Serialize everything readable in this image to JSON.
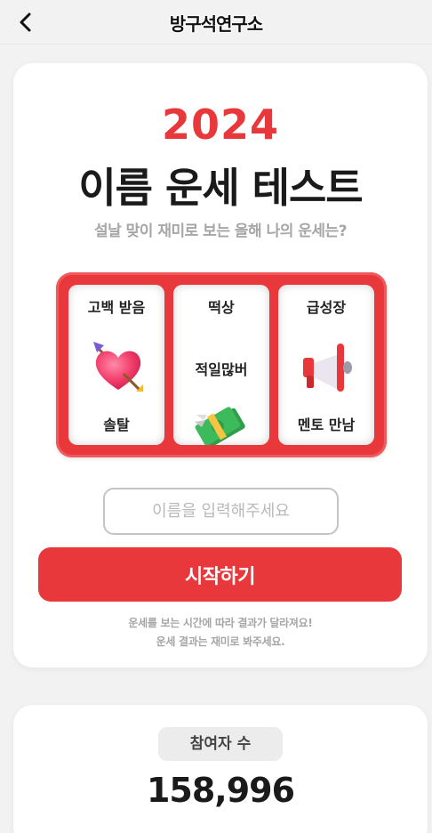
{
  "header": {
    "back_icon": "chevron-left-icon",
    "brand": "방구석연구소"
  },
  "main": {
    "year": "2024",
    "title": "이름 운세 테스트",
    "subtitle": "설날 맞이 재미로 보는 올해 나의 운세는?",
    "reels": [
      {
        "top": "고백 받음",
        "icon": "heart-arrow-icon",
        "bottom": "솔탈"
      },
      {
        "top": "떡상",
        "middle": "적일많버",
        "icon": "money-icon"
      },
      {
        "top": "급성장",
        "icon": "megaphone-icon",
        "bottom": "멘토 만남"
      }
    ],
    "input_placeholder": "이름을 입력해주세요",
    "start_label": "시작하기",
    "note_line1": "운세를 보는 시간에 따라 결과가 달라져요!",
    "note_line2": "운세 결과는 재미로 봐주세요."
  },
  "stats": {
    "label": "참여자 수",
    "count": "158,996"
  },
  "colors": {
    "accent": "#e8383b",
    "background": "#f2f2f2",
    "text_dark": "#1a1a1a",
    "text_muted": "#a6a6a6"
  }
}
